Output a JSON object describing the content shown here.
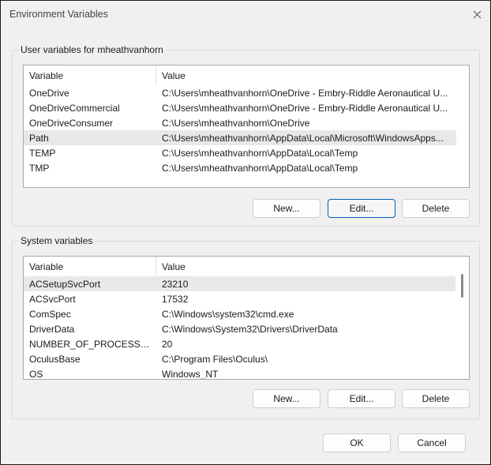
{
  "window": {
    "title": "Environment Variables"
  },
  "user": {
    "group_label": "User variables for mheathvanhorn",
    "columns": [
      "Variable",
      "Value"
    ],
    "rows": [
      {
        "name": "OneDrive",
        "value": "C:\\Users\\mheathvanhorn\\OneDrive - Embry-Riddle Aeronautical U..."
      },
      {
        "name": "OneDriveCommercial",
        "value": "C:\\Users\\mheathvanhorn\\OneDrive - Embry-Riddle Aeronautical U..."
      },
      {
        "name": "OneDriveConsumer",
        "value": "C:\\Users\\mheathvanhorn\\OneDrive"
      },
      {
        "name": "Path",
        "value": "C:\\Users\\mheathvanhorn\\AppData\\Local\\Microsoft\\WindowsApps..."
      },
      {
        "name": "TEMP",
        "value": "C:\\Users\\mheathvanhorn\\AppData\\Local\\Temp"
      },
      {
        "name": "TMP",
        "value": "C:\\Users\\mheathvanhorn\\AppData\\Local\\Temp"
      }
    ],
    "buttons": {
      "new": "New...",
      "edit": "Edit...",
      "delete": "Delete"
    }
  },
  "system": {
    "group_label": "System variables",
    "columns": [
      "Variable",
      "Value"
    ],
    "rows": [
      {
        "name": "ACSetupSvcPort",
        "value": "23210"
      },
      {
        "name": "ACSvcPort",
        "value": "17532"
      },
      {
        "name": "ComSpec",
        "value": "C:\\Windows\\system32\\cmd.exe"
      },
      {
        "name": "DriverData",
        "value": "C:\\Windows\\System32\\Drivers\\DriverData"
      },
      {
        "name": "NUMBER_OF_PROCESSORS",
        "value": "20"
      },
      {
        "name": "OculusBase",
        "value": "C:\\Program Files\\Oculus\\"
      },
      {
        "name": "OS",
        "value": "Windows_NT"
      }
    ],
    "buttons": {
      "new": "New...",
      "edit": "Edit...",
      "delete": "Delete"
    }
  },
  "footer": {
    "ok": "OK",
    "cancel": "Cancel"
  },
  "icons": {
    "close": "close-icon"
  }
}
